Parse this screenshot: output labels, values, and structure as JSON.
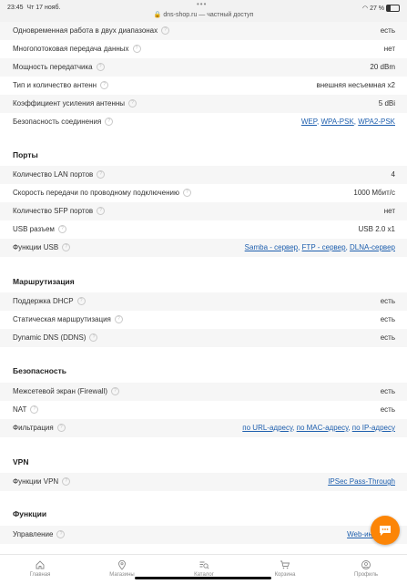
{
  "statusbar": {
    "time": "23:45",
    "date": "Чт 17 нояб.",
    "url": "dns-shop.ru — частный доступ",
    "battery": "27 %",
    "battery_level": 0.27
  },
  "rows_wireless": [
    {
      "name": "Одновременная работа в двух диапазонах",
      "value": "есть"
    },
    {
      "name": "Многопотоковая передача данных",
      "value": "нет"
    },
    {
      "name": "Мощность передатчика",
      "value": "20 dBm"
    },
    {
      "name": "Тип и количество антенн",
      "value": "внешняя несъемная x2"
    },
    {
      "name": "Коэффициент усиления антенны",
      "value": "5 dBi"
    }
  ],
  "security_conn": {
    "name": "Безопасность соединения",
    "links": [
      "WEP",
      "WPA-PSK",
      "WPA2-PSK"
    ]
  },
  "sections": {
    "ports": "Порты",
    "routing": "Маршрутизация",
    "security": "Безопасность",
    "vpn": "VPN",
    "functions": "Функции"
  },
  "rows_ports": [
    {
      "name": "Количество LAN портов",
      "value": "4"
    },
    {
      "name": "Скорость передачи по проводному подключению",
      "value": "1000 Мбит/с"
    },
    {
      "name": "Количество SFP портов",
      "value": "нет"
    },
    {
      "name": "USB разъем",
      "value": "USB 2.0 x1"
    }
  ],
  "usb_functions": {
    "name": "Функции USB",
    "links": [
      "Samba - сервер",
      "FTP - сервер",
      "DLNA-сервер"
    ]
  },
  "rows_routing": [
    {
      "name": "Поддержка DHCP",
      "value": "есть"
    },
    {
      "name": "Статическая маршрутизация",
      "value": "есть"
    },
    {
      "name": "Dynamic DNS (DDNS)",
      "value": "есть"
    }
  ],
  "rows_security": [
    {
      "name": "Межсетевой экран (Firewall)",
      "value": "есть"
    },
    {
      "name": "NAT",
      "value": "есть"
    }
  ],
  "filtering": {
    "name": "Фильтрация",
    "links": [
      "по URL-адресу",
      "по MAC-адресу",
      "по IP-адресу"
    ]
  },
  "vpn_functions": {
    "name": "Функции VPN",
    "links": [
      "IPSec Pass-Through"
    ]
  },
  "management": {
    "name": "Управление",
    "links": [
      "Web-инте"
    ]
  },
  "nav": [
    {
      "label": "Главная",
      "icon": "home-icon"
    },
    {
      "label": "Магазины",
      "icon": "location-pin-icon"
    },
    {
      "label": "Каталог",
      "icon": "catalog-search-icon"
    },
    {
      "label": "Корзина",
      "icon": "cart-icon"
    },
    {
      "label": "Профиль",
      "icon": "profile-icon"
    }
  ]
}
